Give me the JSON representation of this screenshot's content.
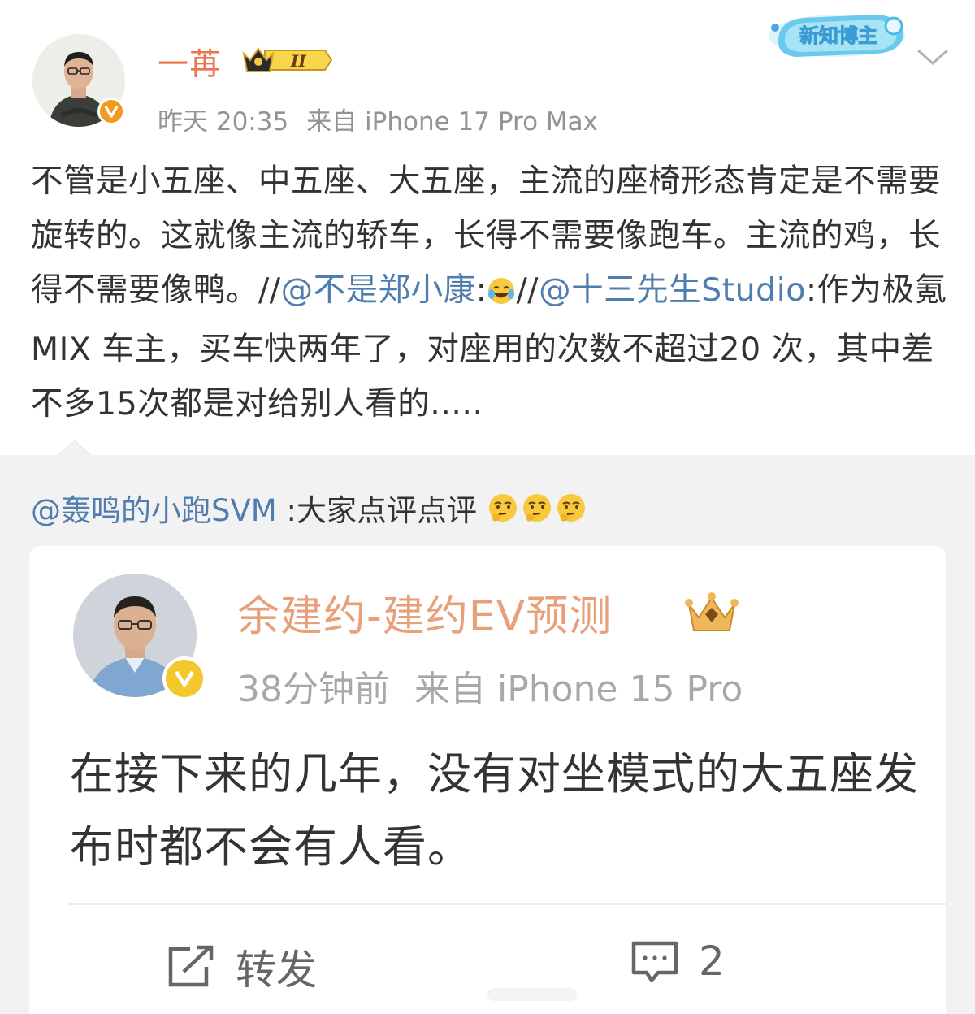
{
  "post": {
    "author": "一苒",
    "vip_level": "II",
    "time": "昨天 20:35",
    "source": "来自 iPhone 17 Pro Max",
    "blogger_badge": "新知博主",
    "text_before": "不管是小五座、中五座、大五座，主流的座椅形态肯定是不需要旋转的。这就像主流的轿车，长得不需要像跑车。主流的鸡，长得不需要像鸭。//",
    "mention_1": "@不是郑小康",
    "colon_1": ":",
    "sep": "//",
    "mention_2": "@十三先生Studio",
    "text_after": ":作为极氪MIX 车主，买车快两年了，对座用的次数不超过20 次，其中差不多15次都是对给别人看的....."
  },
  "retweet": {
    "mention": "@轰鸣的小跑SVM",
    "comment": " :大家点评点评",
    "card": {
      "author": "余建约-建约EV预测",
      "time": "38分钟前",
      "source": "来自 iPhone 15 Pro",
      "text": "在接下来的几年，没有对坐模式的大五座发布时都不会有人看。",
      "repost_label": "转发",
      "comment_count": "2"
    }
  },
  "colors": {
    "author_name": "#eb7350",
    "link": "#507daf",
    "meta": "#939393",
    "retweet_bg": "#f2f2f2",
    "verified_orange": "#f29a1b",
    "verified_yellow": "#f4c72c"
  },
  "icons": [
    "verified-icon",
    "vip-crown-icon",
    "chevron-down-icon",
    "laughing-cry-emoji",
    "thinking-emoji",
    "repost-icon",
    "comment-icon"
  ]
}
